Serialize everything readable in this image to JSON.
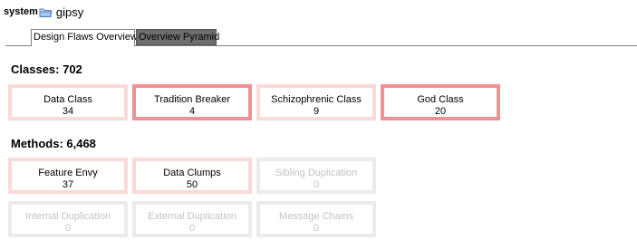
{
  "header": {
    "system_label": "system",
    "project_name": "gipsy"
  },
  "tabs": [
    {
      "label": "Design Flaws Overview"
    },
    {
      "label": "Overview Pyramid"
    }
  ],
  "classes": {
    "title": "Classes: 702",
    "cards": [
      {
        "label": "Data Class",
        "value": "34"
      },
      {
        "label": "Tradition Breaker",
        "value": "4"
      },
      {
        "label": "Schizophrenic Class",
        "value": "9"
      },
      {
        "label": "God Class",
        "value": "20"
      }
    ]
  },
  "methods": {
    "title": "Methods: 6,468",
    "cards": [
      {
        "label": "Feature Envy",
        "value": "37"
      },
      {
        "label": "Data Clumps",
        "value": "50"
      },
      {
        "label": "Sibling Duplication",
        "value": "0"
      },
      {
        "label": "Internal Duplication",
        "value": "0"
      },
      {
        "label": "External Duplication",
        "value": "0"
      },
      {
        "label": "Message Chains",
        "value": "0"
      }
    ]
  },
  "colors": {
    "light": "#fad9d9",
    "strong": "#ef9095",
    "inactive": "#ebebeb",
    "inactive_text": "#c3c3c3"
  }
}
